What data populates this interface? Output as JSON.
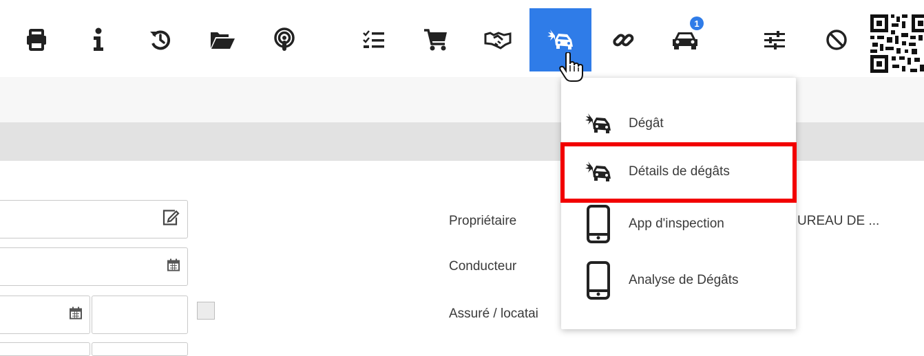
{
  "toolbar": {
    "icons": [
      "print-icon",
      "info-icon",
      "history-icon",
      "folder-open-icon",
      "podcast-icon",
      "task-list-icon",
      "cart-icon",
      "handshake-icon",
      "car-crash-icon",
      "link-icon",
      "car-icon",
      "sliders-icon",
      "ban-icon",
      "qr-code-icon"
    ],
    "active_item": "car-crash-icon",
    "car_badge": "1",
    "accent_color": "#2f7ce8"
  },
  "dropdown": {
    "items": [
      {
        "label": "Dégât",
        "icon": "car-crash-icon"
      },
      {
        "label": "Détails de dégâts",
        "icon": "car-crash-icon",
        "highlighted": true
      },
      {
        "label": "App d'inspection",
        "icon": "mobile-phone-icon"
      },
      {
        "label": "Analyse de Dégâts",
        "icon": "mobile-phone-icon"
      }
    ],
    "highlight_color": "#f20000"
  },
  "form": {
    "labels": {
      "owner": "Propriétaire",
      "driver": "Conducteur",
      "insured": "Assuré / locatai"
    },
    "owner_value": "UREAU DE ..."
  }
}
